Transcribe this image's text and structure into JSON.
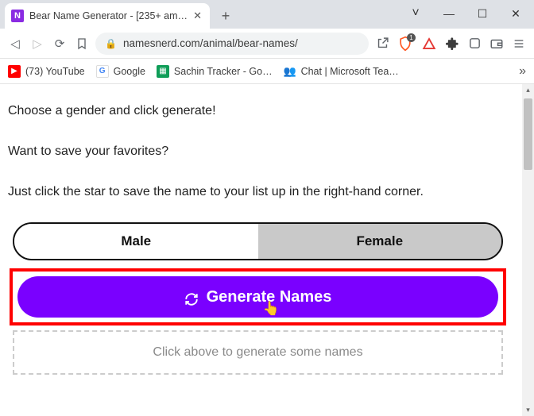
{
  "window": {
    "tab_title": "Bear Name Generator - [235+ am…",
    "favicon_letter": "N"
  },
  "toolbar": {
    "url": "namesnerd.com/animal/bear-names/",
    "shield_badge": "1"
  },
  "bookmarks": {
    "youtube": "(73) YouTube",
    "google": "Google",
    "sheets": "Sachin Tracker - Go…",
    "teams": "Chat | Microsoft Tea…"
  },
  "page": {
    "line1": "Choose a gender and click generate!",
    "line2": "Want to save your favorites?",
    "line3": "Just click the star to save the name to your list up in the right-hand corner.",
    "male_label": "Male",
    "female_label": "Female",
    "generate_label": "Generate Names",
    "placeholder": "Click above to generate some names"
  }
}
